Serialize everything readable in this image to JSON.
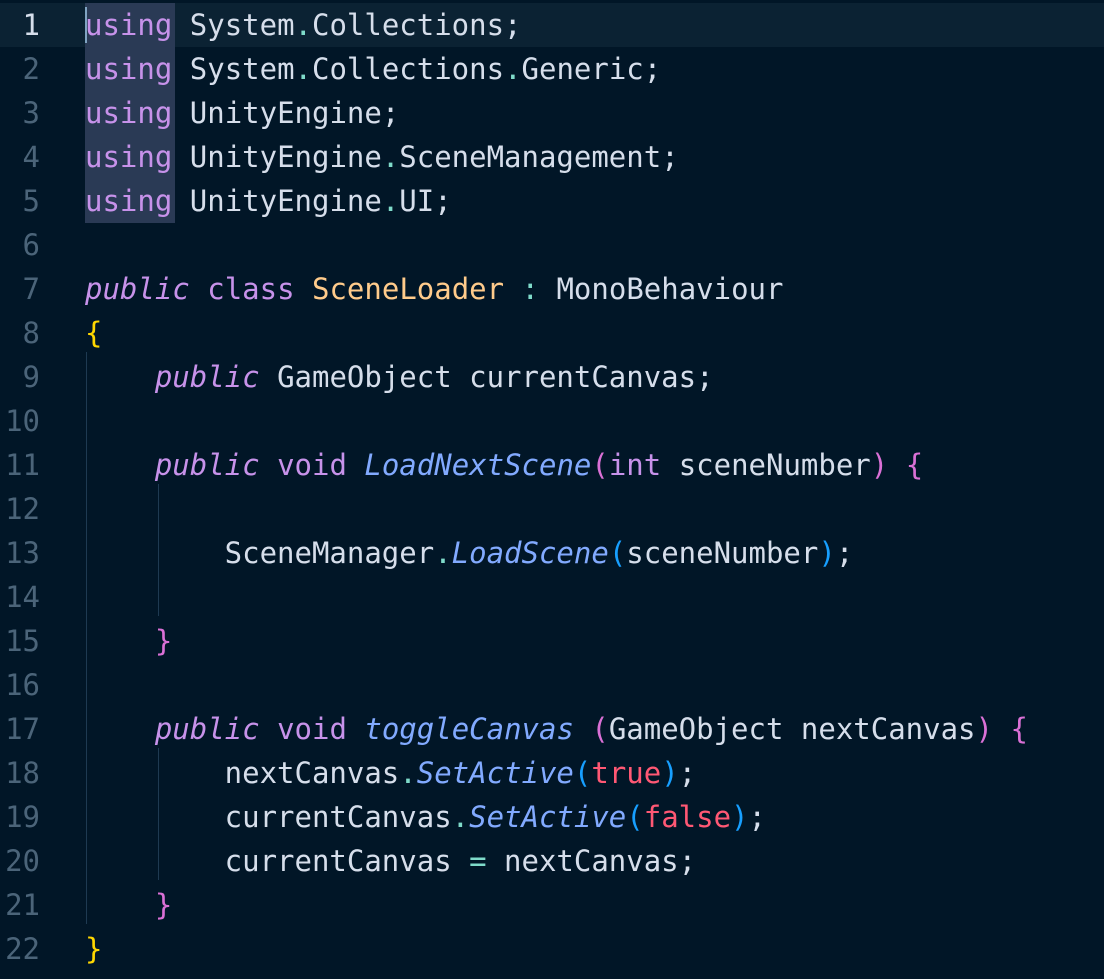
{
  "editor": {
    "current_line": 1,
    "colors": {
      "background": "#011627",
      "keyword": "#c792ea",
      "type": "#ffcb8b",
      "method": "#82aaff",
      "bool": "#ff5874",
      "brace_level1": "#ffd700",
      "brace_level2": "#da70d6",
      "paren": "#179fff"
    },
    "lines": [
      {
        "num": "1",
        "tokens": [
          {
            "c": "kw-using",
            "t": "using"
          },
          {
            "c": "plain",
            "t": " System"
          },
          {
            "c": "punct",
            "t": "."
          },
          {
            "c": "plain",
            "t": "Collections;"
          }
        ]
      },
      {
        "num": "2",
        "tokens": [
          {
            "c": "kw-using",
            "t": "using"
          },
          {
            "c": "plain",
            "t": " System"
          },
          {
            "c": "punct",
            "t": "."
          },
          {
            "c": "plain",
            "t": "Collections"
          },
          {
            "c": "punct",
            "t": "."
          },
          {
            "c": "plain",
            "t": "Generic;"
          }
        ]
      },
      {
        "num": "3",
        "tokens": [
          {
            "c": "kw-using",
            "t": "using"
          },
          {
            "c": "plain",
            "t": " UnityEngine;"
          }
        ]
      },
      {
        "num": "4",
        "tokens": [
          {
            "c": "kw-using",
            "t": "using"
          },
          {
            "c": "plain",
            "t": " UnityEngine"
          },
          {
            "c": "punct",
            "t": "."
          },
          {
            "c": "plain",
            "t": "SceneManagement;"
          }
        ]
      },
      {
        "num": "5",
        "tokens": [
          {
            "c": "kw-using",
            "t": "using"
          },
          {
            "c": "plain",
            "t": " UnityEngine"
          },
          {
            "c": "punct",
            "t": "."
          },
          {
            "c": "plain",
            "t": "UI;"
          }
        ]
      },
      {
        "num": "6",
        "tokens": []
      },
      {
        "num": "7",
        "tokens": [
          {
            "c": "kw-italic",
            "t": "public"
          },
          {
            "c": "plain",
            "t": " "
          },
          {
            "c": "kw",
            "t": "class"
          },
          {
            "c": "plain",
            "t": " "
          },
          {
            "c": "type",
            "t": "SceneLoader"
          },
          {
            "c": "plain",
            "t": " "
          },
          {
            "c": "punct",
            "t": ":"
          },
          {
            "c": "plain",
            "t": " MonoBehaviour"
          }
        ]
      },
      {
        "num": "8",
        "tokens": [
          {
            "c": "brace-y",
            "t": "{"
          }
        ]
      },
      {
        "num": "9",
        "tokens": [
          {
            "c": "plain",
            "t": "    "
          },
          {
            "c": "kw-italic",
            "t": "public"
          },
          {
            "c": "plain",
            "t": " GameObject currentCanvas;"
          }
        ]
      },
      {
        "num": "10",
        "tokens": []
      },
      {
        "num": "11",
        "tokens": [
          {
            "c": "plain",
            "t": "    "
          },
          {
            "c": "kw-italic",
            "t": "public"
          },
          {
            "c": "plain",
            "t": " "
          },
          {
            "c": "kw",
            "t": "void"
          },
          {
            "c": "plain",
            "t": " "
          },
          {
            "c": "method",
            "t": "LoadNextScene"
          },
          {
            "c": "brace-p",
            "t": "("
          },
          {
            "c": "kw",
            "t": "int"
          },
          {
            "c": "plain",
            "t": " sceneNumber"
          },
          {
            "c": "brace-p",
            "t": ")"
          },
          {
            "c": "plain",
            "t": " "
          },
          {
            "c": "brace-p",
            "t": "{"
          }
        ]
      },
      {
        "num": "12",
        "tokens": []
      },
      {
        "num": "13",
        "tokens": [
          {
            "c": "plain",
            "t": "        SceneManager"
          },
          {
            "c": "punct",
            "t": "."
          },
          {
            "c": "method",
            "t": "LoadScene"
          },
          {
            "c": "paren-b",
            "t": "("
          },
          {
            "c": "plain",
            "t": "sceneNumber"
          },
          {
            "c": "paren-b",
            "t": ")"
          },
          {
            "c": "plain",
            "t": ";"
          }
        ]
      },
      {
        "num": "14",
        "tokens": []
      },
      {
        "num": "15",
        "tokens": [
          {
            "c": "plain",
            "t": "    "
          },
          {
            "c": "brace-p",
            "t": "}"
          }
        ]
      },
      {
        "num": "16",
        "tokens": []
      },
      {
        "num": "17",
        "tokens": [
          {
            "c": "plain",
            "t": "    "
          },
          {
            "c": "kw-italic",
            "t": "public"
          },
          {
            "c": "plain",
            "t": " "
          },
          {
            "c": "kw",
            "t": "void"
          },
          {
            "c": "plain",
            "t": " "
          },
          {
            "c": "method",
            "t": "toggleCanvas"
          },
          {
            "c": "plain",
            "t": " "
          },
          {
            "c": "brace-p",
            "t": "("
          },
          {
            "c": "plain",
            "t": "GameObject nextCanvas"
          },
          {
            "c": "brace-p",
            "t": ")"
          },
          {
            "c": "plain",
            "t": " "
          },
          {
            "c": "brace-p",
            "t": "{"
          }
        ]
      },
      {
        "num": "18",
        "tokens": [
          {
            "c": "plain",
            "t": "        nextCanvas"
          },
          {
            "c": "punct",
            "t": "."
          },
          {
            "c": "method",
            "t": "SetActive"
          },
          {
            "c": "paren-b",
            "t": "("
          },
          {
            "c": "true",
            "t": "true"
          },
          {
            "c": "paren-b",
            "t": ")"
          },
          {
            "c": "plain",
            "t": ";"
          }
        ]
      },
      {
        "num": "19",
        "tokens": [
          {
            "c": "plain",
            "t": "        currentCanvas"
          },
          {
            "c": "punct",
            "t": "."
          },
          {
            "c": "method",
            "t": "SetActive"
          },
          {
            "c": "paren-b",
            "t": "("
          },
          {
            "c": "false",
            "t": "false"
          },
          {
            "c": "paren-b",
            "t": ")"
          },
          {
            "c": "plain",
            "t": ";"
          }
        ]
      },
      {
        "num": "20",
        "tokens": [
          {
            "c": "plain",
            "t": "        currentCanvas "
          },
          {
            "c": "punct",
            "t": "="
          },
          {
            "c": "plain",
            "t": " nextCanvas;"
          }
        ]
      },
      {
        "num": "21",
        "tokens": [
          {
            "c": "plain",
            "t": "    "
          },
          {
            "c": "brace-p",
            "t": "}"
          }
        ]
      },
      {
        "num": "22",
        "tokens": [
          {
            "c": "brace-y",
            "t": "}"
          }
        ]
      }
    ]
  }
}
